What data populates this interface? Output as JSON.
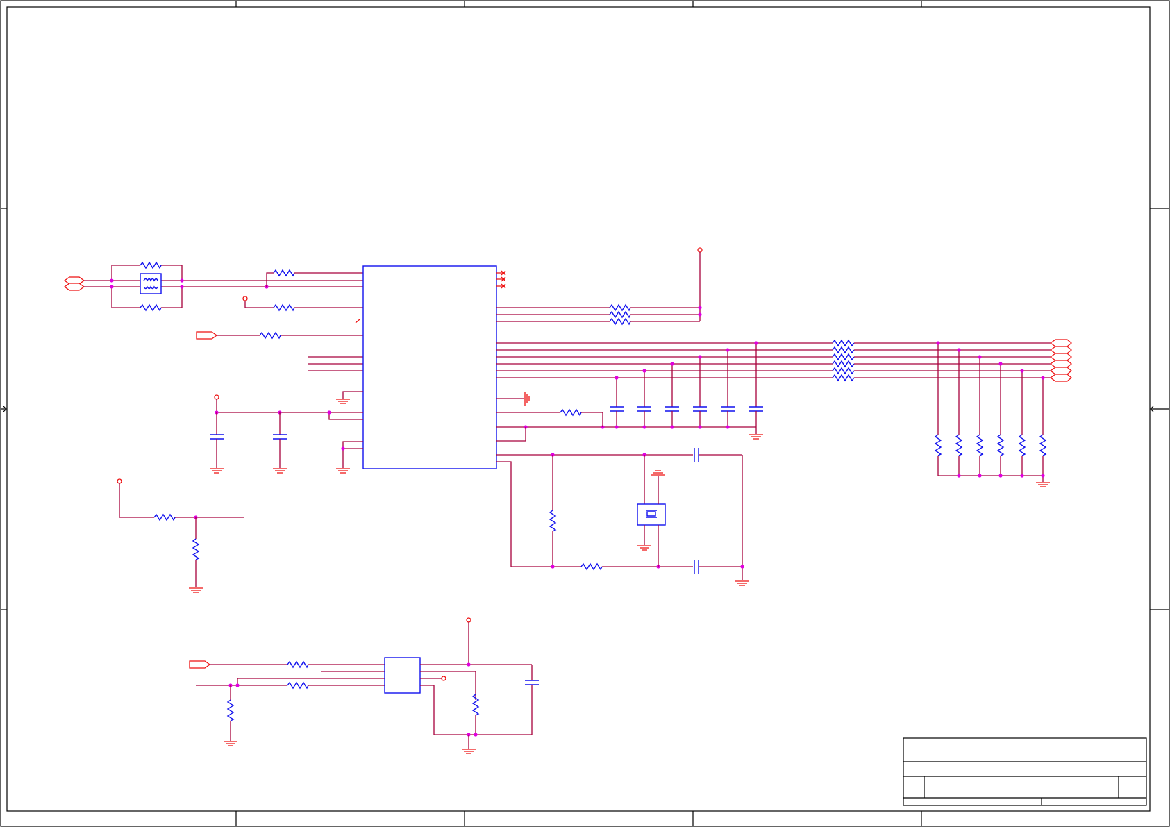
{
  "sheet": {
    "width_in_pixels_is_layout": true,
    "colors": {
      "wire": "#a8003c",
      "component": "#1111ee",
      "power_ground": "#ee1111",
      "junction": "#e000e0",
      "frame": "#000000"
    },
    "components": {
      "main_ic": "ic-main",
      "driver_ic": "ic-small",
      "common_mode_choke": "choke",
      "crystal": "crystal"
    },
    "title_block": {
      "title": "",
      "size": "",
      "number": "",
      "rev": "",
      "date": "",
      "sheet": ""
    }
  }
}
